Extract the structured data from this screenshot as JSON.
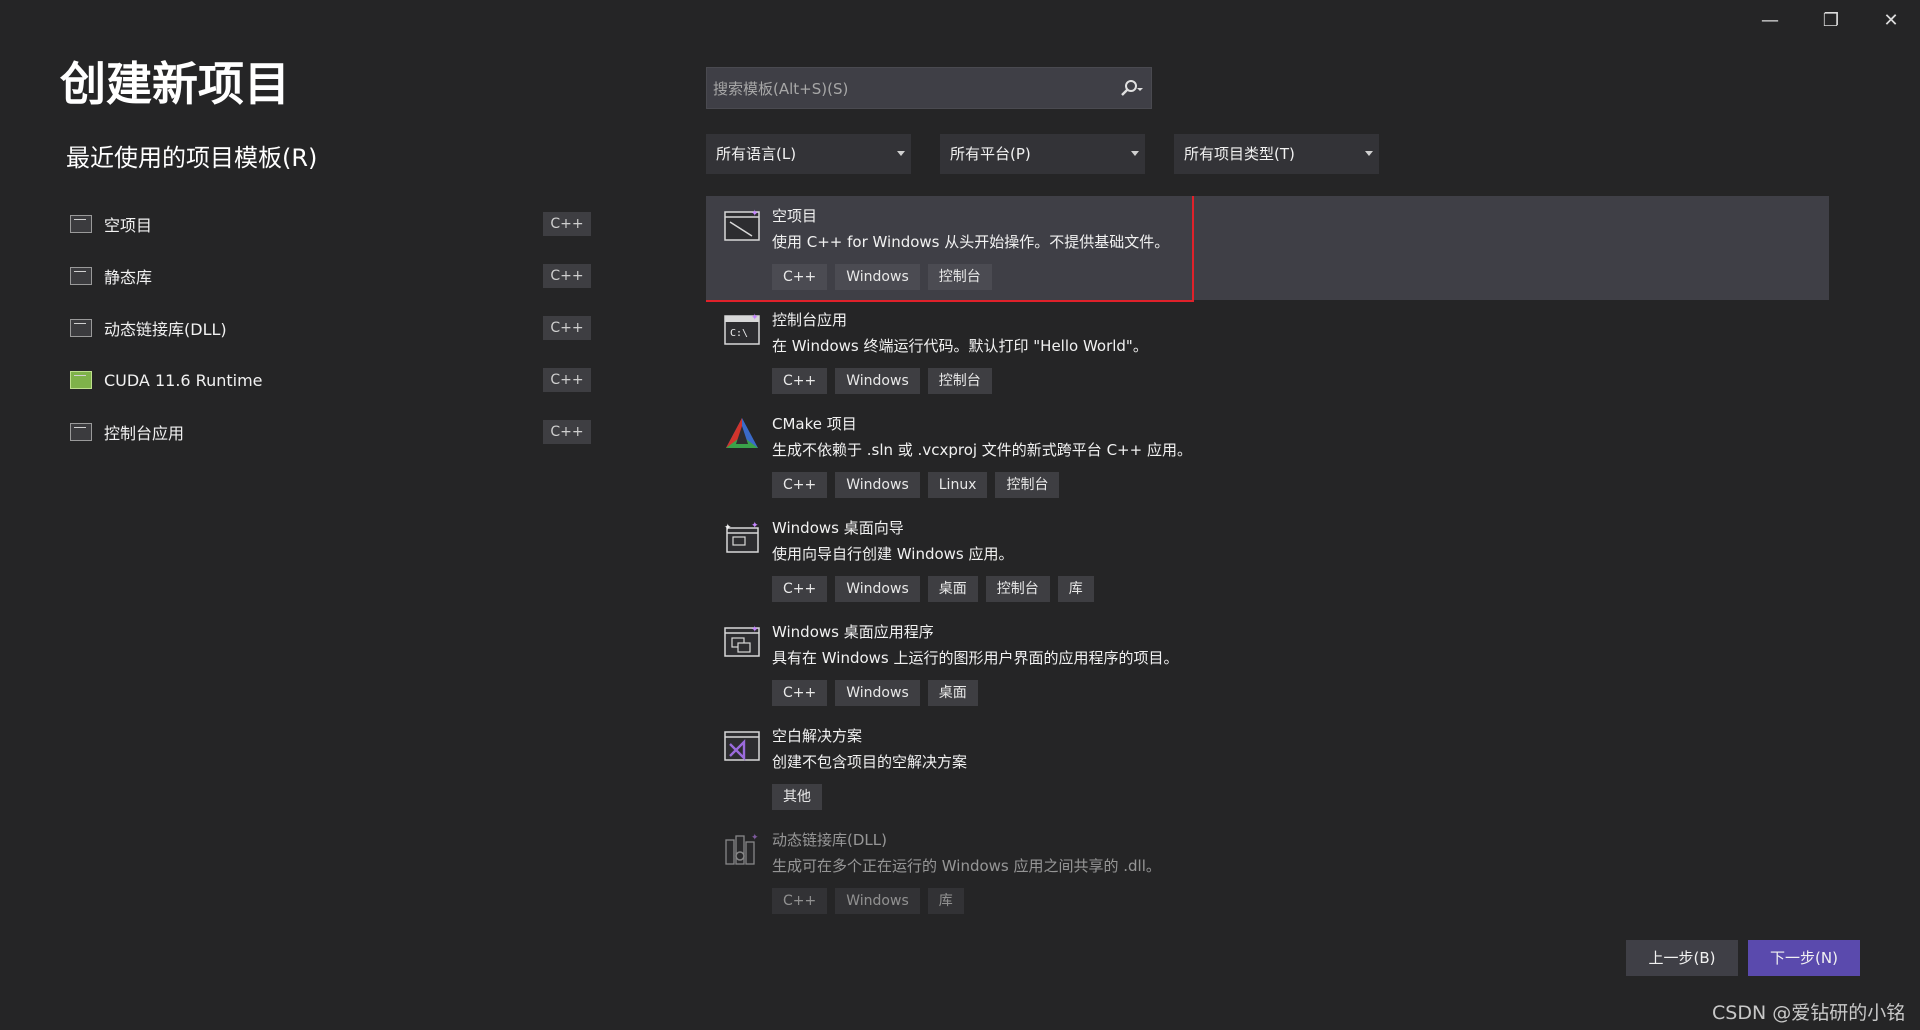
{
  "window": {
    "minimize_label": "—",
    "restore_label": "❐",
    "close_label": "✕"
  },
  "title": "创建新项目",
  "recent": {
    "heading": "最近使用的项目模板(R)",
    "items": [
      {
        "label": "空项目",
        "lang": "C++",
        "icon": "empty-project-icon"
      },
      {
        "label": "静态库",
        "lang": "C++",
        "icon": "static-library-icon"
      },
      {
        "label": "动态链接库(DLL)",
        "lang": "C++",
        "icon": "dll-icon"
      },
      {
        "label": "CUDA 11.6 Runtime",
        "lang": "C++",
        "icon": "cuda-icon"
      },
      {
        "label": "控制台应用",
        "lang": "C++",
        "icon": "console-app-icon"
      }
    ]
  },
  "search": {
    "placeholder": "搜索模板(Alt+S)(S)",
    "value": ""
  },
  "filters": {
    "language": "所有语言(L)",
    "platform": "所有平台(P)",
    "project_type": "所有项目类型(T)"
  },
  "templates": [
    {
      "name": "空项目",
      "desc": "使用 C++ for Windows 从头开始操作。不提供基础文件。",
      "tags": [
        "C++",
        "Windows",
        "控制台"
      ],
      "icon": "empty-project-icon"
    },
    {
      "name": "控制台应用",
      "desc": "在 Windows 终端运行代码。默认打印 \"Hello World\"。",
      "tags": [
        "C++",
        "Windows",
        "控制台"
      ],
      "icon": "console-app-icon"
    },
    {
      "name": "CMake 项目",
      "desc": "生成不依赖于 .sln 或 .vcxproj 文件的新式跨平台 C++ 应用。",
      "tags": [
        "C++",
        "Windows",
        "Linux",
        "控制台"
      ],
      "icon": "cmake-icon"
    },
    {
      "name": "Windows 桌面向导",
      "desc": "使用向导自行创建 Windows 应用。",
      "tags": [
        "C++",
        "Windows",
        "桌面",
        "控制台",
        "库"
      ],
      "icon": "desktop-wizard-icon"
    },
    {
      "name": "Windows 桌面应用程序",
      "desc": "具有在 Windows 上运行的图形用户界面的应用程序的项目。",
      "tags": [
        "C++",
        "Windows",
        "桌面"
      ],
      "icon": "desktop-app-icon"
    },
    {
      "name": "空白解决方案",
      "desc": "创建不包含项目的空解决方案",
      "tags": [
        "其他"
      ],
      "icon": "blank-solution-icon"
    },
    {
      "name": "动态链接库(DLL)",
      "desc": "生成可在多个正在运行的 Windows 应用之间共享的 .dll。",
      "tags": [
        "C++",
        "Windows",
        "库"
      ],
      "icon": "dll-icon"
    }
  ],
  "buttons": {
    "back": "上一步(B)",
    "next": "下一步(N)"
  },
  "watermark": "CSDN @爱钻研的小铭"
}
